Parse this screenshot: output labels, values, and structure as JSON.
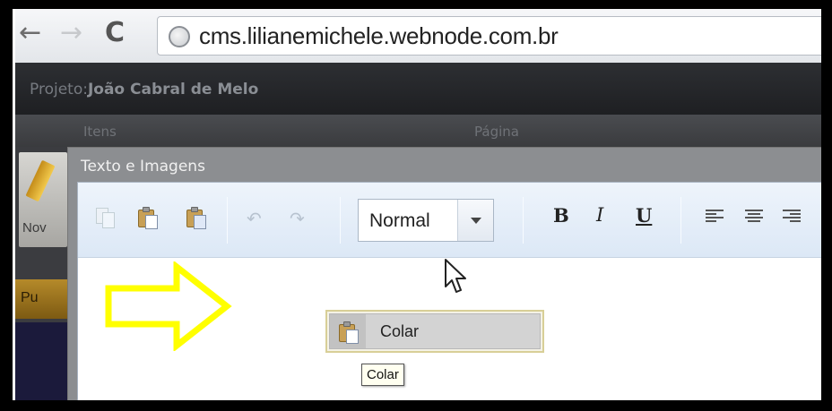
{
  "browser": {
    "back_icon": "back-arrow-icon",
    "forward_icon": "forward-arrow-icon",
    "reload_icon": "reload-icon",
    "site_icon": "globe-icon",
    "url": "cms.lilianemichele.webnode.com.br"
  },
  "project": {
    "label": "Projeto:",
    "name": "João Cabral de Melo"
  },
  "columns": {
    "itens": "Itens",
    "pagina": "Página"
  },
  "sidebar": {
    "tool_label": "Nov",
    "publish_label": "Pu"
  },
  "dialog": {
    "title": "Texto e Imagens"
  },
  "toolbar": {
    "format_value": "Normal",
    "bold": "B",
    "italic": "I",
    "underline": "U",
    "icons": [
      "copy-icon",
      "paste-icon",
      "paste-from-word-icon",
      "undo-icon",
      "redo-icon",
      "align-left-icon",
      "align-center-icon",
      "align-right-icon"
    ]
  },
  "context_menu": {
    "items": [
      {
        "label": "Colar",
        "icon": "paste-icon"
      }
    ]
  },
  "tooltip": {
    "text": "Colar"
  },
  "colors": {
    "highlight_arrow": "#ffff00",
    "menu_border": "#d8cf97",
    "tooltip_bg": "#fffff0"
  }
}
